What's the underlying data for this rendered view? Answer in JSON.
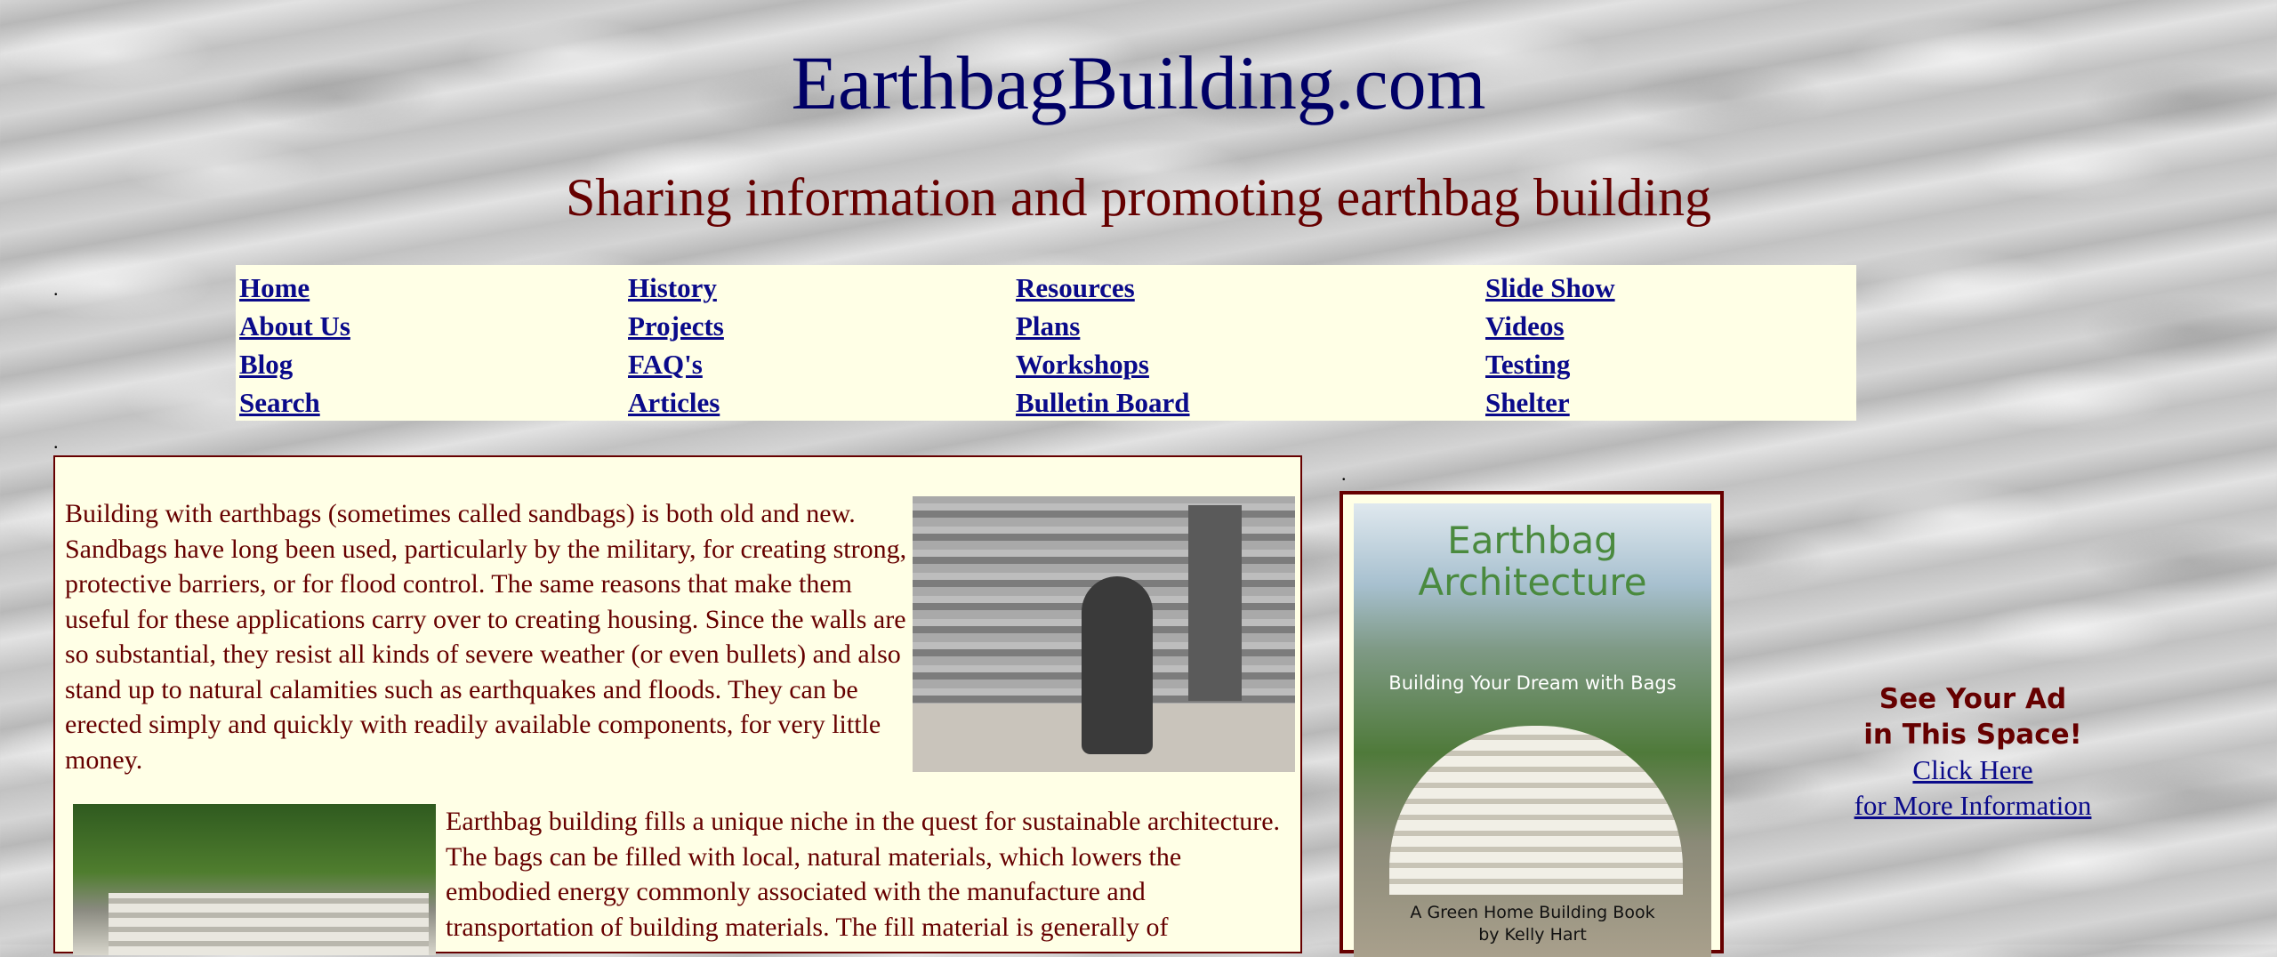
{
  "site": {
    "title": "EarthbagBuilding.com",
    "tagline": "Sharing information and promoting earthbag building",
    "spacer": "."
  },
  "nav": {
    "columns": [
      [
        "Home",
        "About Us",
        "Blog",
        "Search"
      ],
      [
        "History",
        "Projects",
        "FAQ's",
        "Articles"
      ],
      [
        "Resources",
        "Plans",
        "Workshops",
        "Bulletin Board"
      ],
      [
        "Slide Show",
        "Videos",
        "Testing",
        "Shelter"
      ]
    ]
  },
  "main": {
    "para1": "Building with earthbags (sometimes called sandbags) is both old and new. Sandbags have long been used, particularly by the military, for creating strong, protective barriers, or for flood control. The same reasons that make them useful for these applications carry over to creating housing. Since the walls are so substantial, they resist all kinds of severe weather (or even bullets) and also stand up to natural calamities such as earthquakes and floods. They can be erected simply and quickly with readily available components, for very little money.",
    "para2": "Earthbag building fills a unique niche in the quest for sustainable architecture. The bags can be filled with local, natural materials, which lowers the embodied energy commonly associated with the manufacture and transportation of building materials. The fill material is generally of"
  },
  "book": {
    "title": "Earthbag Architecture",
    "subtitle": "Building Your Dream with Bags",
    "series": "A Green Home Building Book",
    "author": "by Kelly Hart"
  },
  "ad": {
    "line1": "See Your Ad",
    "line2": "in This Space!",
    "link1": "Click Here",
    "link2": "for More Information"
  }
}
